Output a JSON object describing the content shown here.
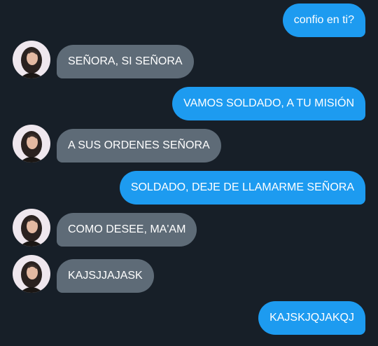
{
  "chat": {
    "messages": [
      {
        "side": "sent",
        "text": "confio en ti?"
      },
      {
        "side": "received",
        "text": "SEÑORA, SI SEÑORA"
      },
      {
        "side": "sent",
        "text": "VAMOS SOLDADO, A TU MISIÓN"
      },
      {
        "side": "received",
        "text": "A SUS ORDENES SEÑORA"
      },
      {
        "side": "sent",
        "text": "SOLDADO, DEJE DE LLAMARME SEÑORA"
      },
      {
        "side": "received",
        "text": "COMO DESEE, MA'AM"
      },
      {
        "side": "received",
        "text": "KAJSJJAJASK"
      },
      {
        "side": "sent",
        "text": "KAJSKJQJAKQJ"
      }
    ]
  },
  "colors": {
    "background": "#171f28",
    "sent_bubble": "#1d9bf0",
    "received_bubble": "#5e6b77"
  },
  "icons": {
    "avatar": "contact-avatar-photo"
  }
}
